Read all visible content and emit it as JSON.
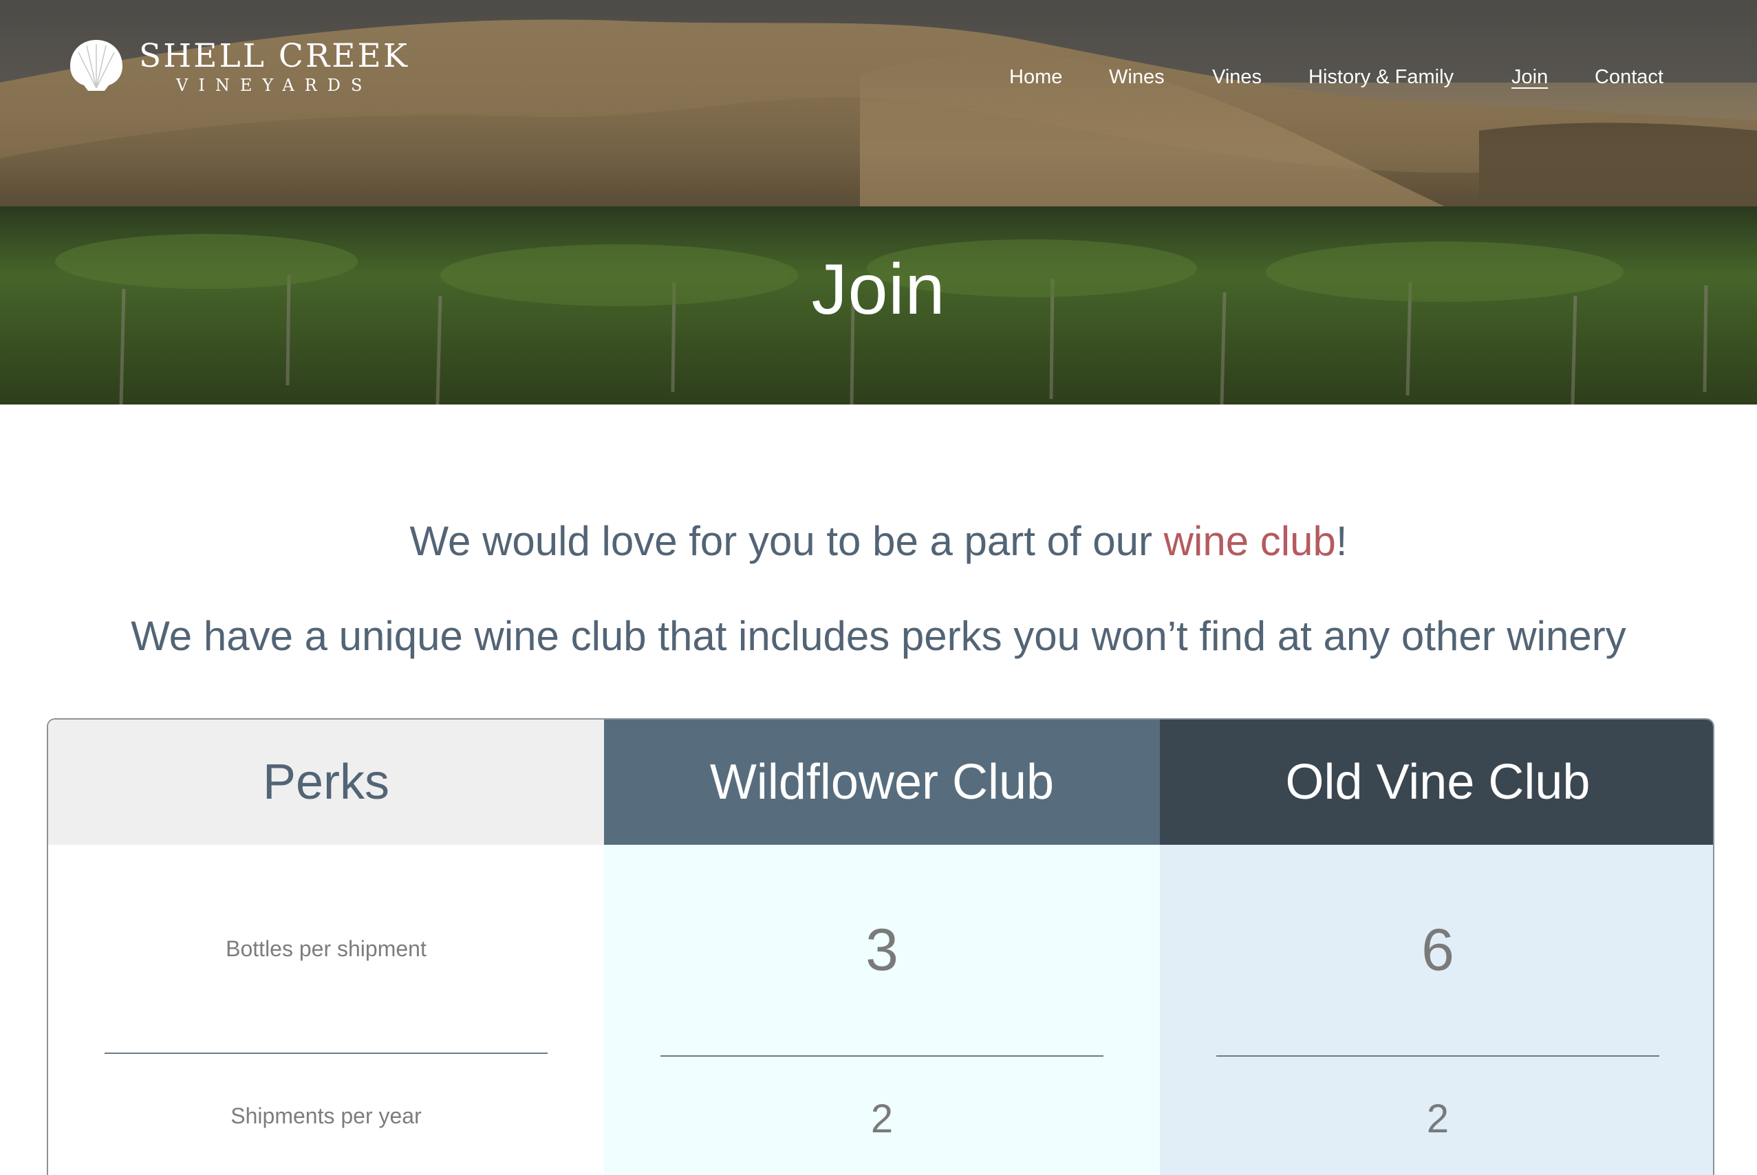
{
  "logo": {
    "name": "SHELL CREEK",
    "subtitle": "VINEYARDS"
  },
  "nav": {
    "items": [
      {
        "label": "Home",
        "active": false
      },
      {
        "label": "Wines",
        "active": false
      },
      {
        "label": "Vines",
        "active": false
      },
      {
        "label": "History & Family",
        "active": false
      },
      {
        "label": "Join",
        "active": true
      },
      {
        "label": "Contact",
        "active": false
      }
    ]
  },
  "hero": {
    "title": "Join"
  },
  "intro": {
    "line1_before": "We would love for you to be a part of our ",
    "line1_link": "wine club",
    "line1_after": "!",
    "line2": "We have a unique wine club that includes perks you won’t find at any other winery"
  },
  "table": {
    "columns": [
      {
        "title": "Perks",
        "color": "#efefef"
      },
      {
        "title": "Wildflower Club",
        "color": "#576d7d"
      },
      {
        "title": "Old Vine Club",
        "color": "#3a4650"
      }
    ],
    "rows": [
      {
        "perk": "Bottles per shipment",
        "wildflower": "3",
        "old_vine": "6"
      },
      {
        "perk": "Shipments per year",
        "wildflower": "2",
        "old_vine": "2"
      }
    ]
  },
  "colors": {
    "text_slate": "#526475",
    "accent": "#b55a5f",
    "wildflower_bg": "#f0feff",
    "old_vine_bg": "#e1eef8"
  }
}
